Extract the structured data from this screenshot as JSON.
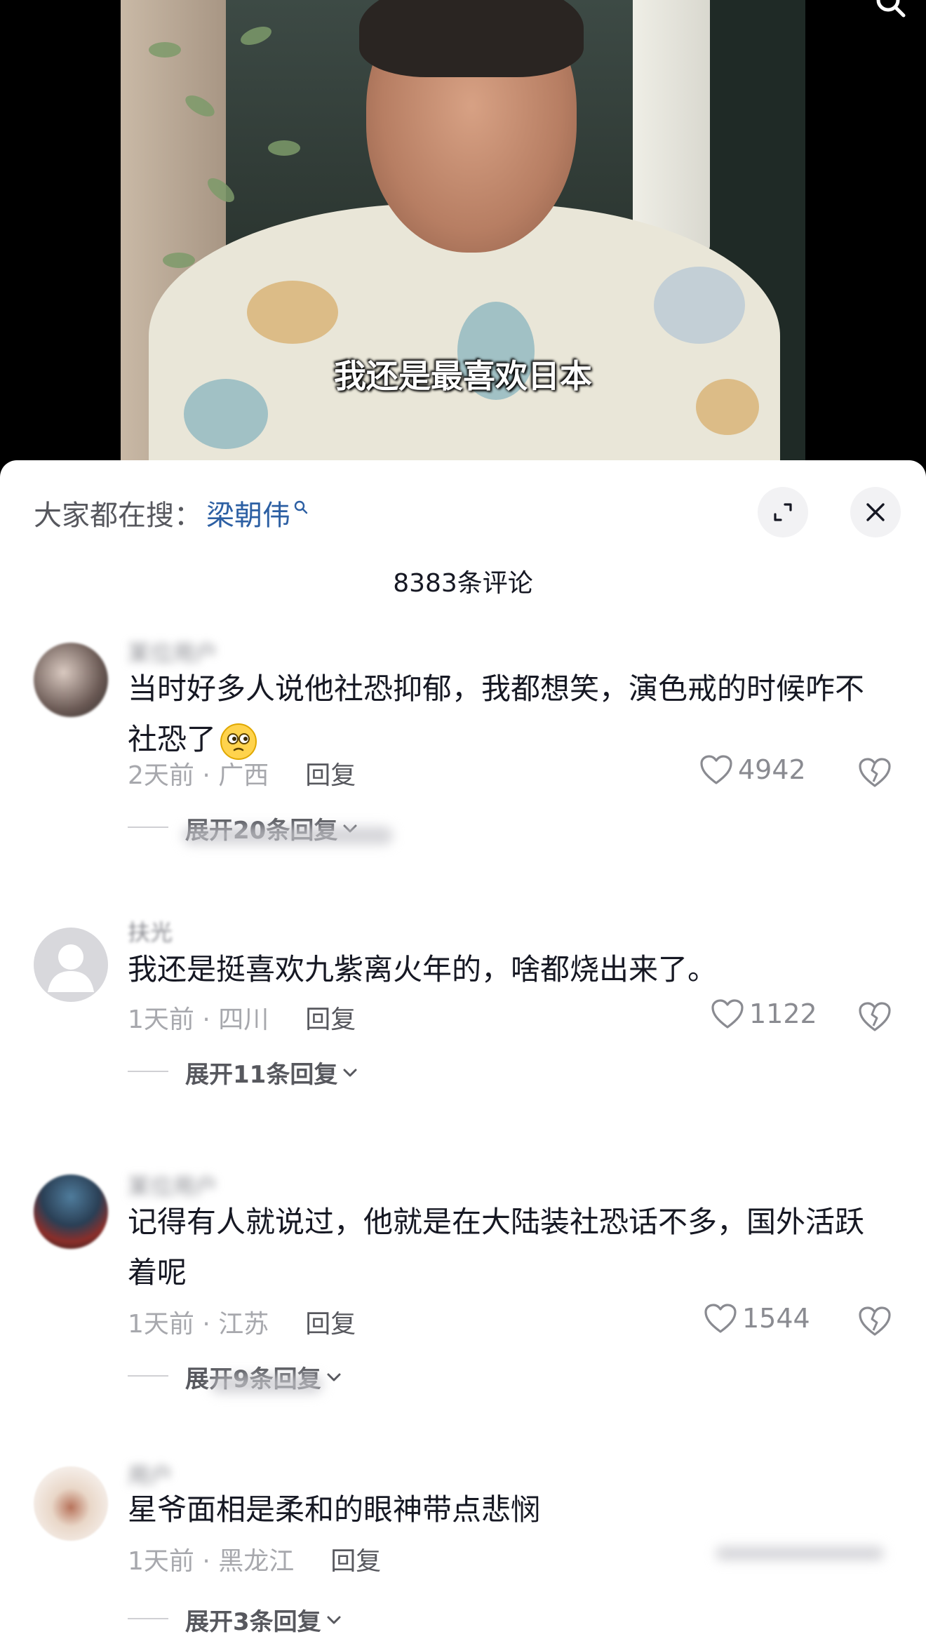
{
  "video": {
    "subtitle": "我还是最喜欢日本"
  },
  "panel": {
    "suggest_prefix": "大家都在搜：",
    "suggest_term": "梁朝伟",
    "comment_count": "8383条评论"
  },
  "comments": [
    {
      "username": "某位用户",
      "text": "当时好多人说他社恐抑郁，我都想笑，演色戒的时候咋不社恐了",
      "time_location": "2天前 · 广西",
      "reply_label": "回复",
      "likes": "4942",
      "expand_label": "展开20条回复"
    },
    {
      "username": "扶光",
      "text": "我还是挺喜欢九紫离火年的，啥都烧出来了。",
      "time_location": "1天前 · 四川",
      "reply_label": "回复",
      "likes": "1122",
      "expand_label": "展开11条回复"
    },
    {
      "username": "某位用户",
      "text": "记得有人就说过，他就是在大陆装社恐话不多，国外活跃着呢",
      "time_location": "1天前 · 江苏",
      "reply_label": "回复",
      "likes": "1544",
      "expand_label": "展开9条回复"
    },
    {
      "username": "用户",
      "text": "星爷面相是柔和的眼神带点悲悯",
      "time_location": "1天前 · 黑龙江",
      "reply_label": "回复",
      "likes": "",
      "expand_label": "展开3条回复"
    }
  ],
  "colors": {
    "accent_link": "#2c5fa3",
    "text_primary": "#161823",
    "text_secondary": "#a7a8ad"
  }
}
